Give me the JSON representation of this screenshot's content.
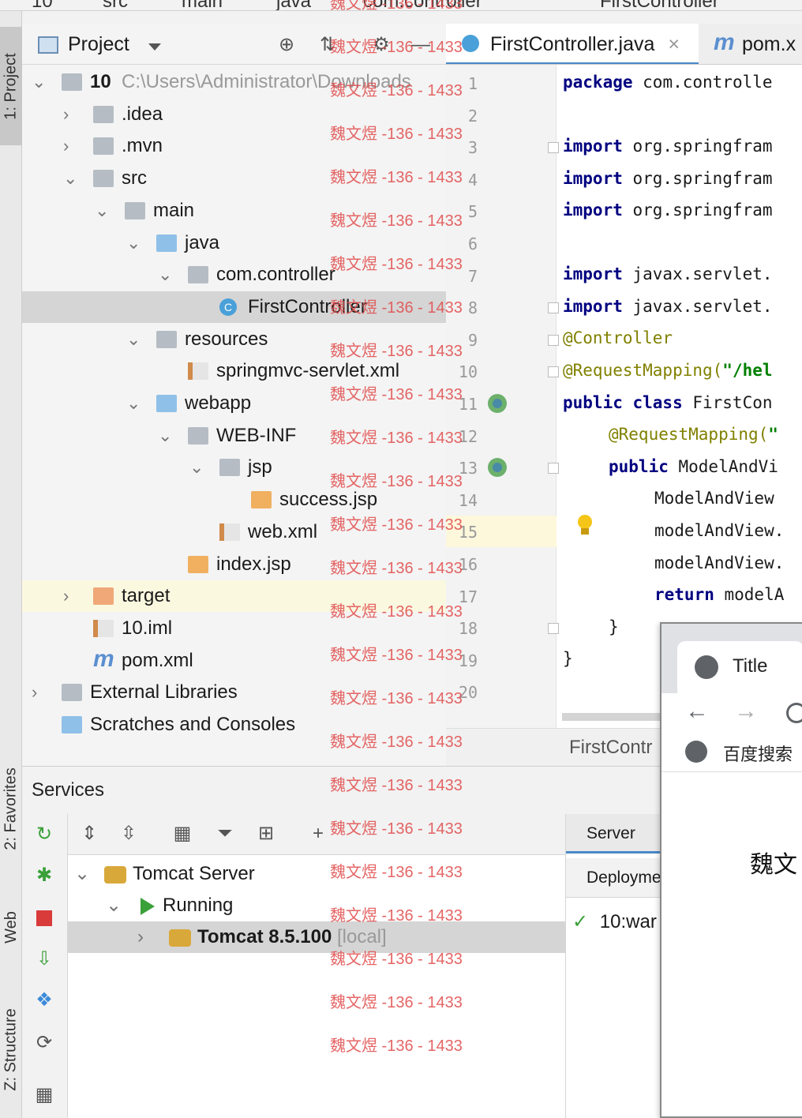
{
  "breadcrumbs": [
    "10",
    "src",
    "main",
    "java",
    "com.controller",
    "FirstController"
  ],
  "left_strip": {
    "tabs": [
      {
        "label": "1: Project"
      },
      {
        "label": "2: Favorites"
      },
      {
        "label": "Web"
      },
      {
        "label": "Z: Structure"
      }
    ]
  },
  "project_panel": {
    "title": "Project",
    "tree": [
      {
        "level": 0,
        "expanded": true,
        "icon": "module-folder-icon",
        "name": "10",
        "path": "C:\\Users\\Administrator\\Downloads"
      },
      {
        "level": 1,
        "expanded": false,
        "icon": "folder-icon",
        "name": ".idea"
      },
      {
        "level": 1,
        "expanded": false,
        "icon": "folder-icon",
        "name": ".mvn"
      },
      {
        "level": 1,
        "expanded": true,
        "icon": "folder-icon",
        "name": "src"
      },
      {
        "level": 2,
        "expanded": true,
        "icon": "folder-icon",
        "name": "main"
      },
      {
        "level": 3,
        "expanded": true,
        "icon": "source-folder-icon",
        "name": "java"
      },
      {
        "level": 4,
        "expanded": true,
        "icon": "package-icon",
        "name": "com.controller"
      },
      {
        "level": 5,
        "icon": "class-icon",
        "name": "FirstController",
        "selected": true
      },
      {
        "level": 3,
        "expanded": true,
        "icon": "resources-folder-icon",
        "name": "resources"
      },
      {
        "level": 4,
        "icon": "xml-file-icon",
        "name": "springmvc-servlet.xml"
      },
      {
        "level": 3,
        "expanded": true,
        "icon": "web-folder-icon",
        "name": "webapp"
      },
      {
        "level": 4,
        "expanded": true,
        "icon": "folder-icon",
        "name": "WEB-INF"
      },
      {
        "level": 5,
        "expanded": true,
        "icon": "folder-icon",
        "name": "jsp"
      },
      {
        "level": 6,
        "icon": "jsp-file-icon",
        "name": "success.jsp"
      },
      {
        "level": 5,
        "icon": "xml-file-icon",
        "name": "web.xml"
      },
      {
        "level": 4,
        "icon": "jsp-file-icon",
        "name": "index.jsp"
      },
      {
        "level": 1,
        "expanded": false,
        "icon": "excluded-folder-icon",
        "name": "target",
        "highlight": true
      },
      {
        "level": 1,
        "icon": "iml-file-icon",
        "name": "10.iml"
      },
      {
        "level": 1,
        "icon": "maven-icon",
        "name": "pom.xml"
      },
      {
        "level": 0,
        "expanded": false,
        "icon": "libraries-icon",
        "name": "External Libraries"
      },
      {
        "level": 0,
        "icon": "scratches-icon",
        "name": "Scratches and Consoles"
      }
    ]
  },
  "editor": {
    "tabs": [
      {
        "label": "FirstController.java",
        "active": true
      },
      {
        "label": "pom.x"
      }
    ],
    "line_numbers": [
      "1",
      "2",
      "3",
      "4",
      "5",
      "6",
      "7",
      "8",
      "9",
      "10",
      "11",
      "12",
      "13",
      "14",
      "15",
      "16",
      "17",
      "18",
      "19",
      "20"
    ],
    "footer_label": "FirstContr"
  },
  "code": {
    "l1": {
      "kw": "package",
      "rest": " com.controlle"
    },
    "l3": {
      "kw": "import",
      "rest": " org.springfram"
    },
    "l4": {
      "kw": "import",
      "rest": " org.springfram"
    },
    "l5": {
      "kw": "import",
      "rest": " org.springfram"
    },
    "l7": {
      "kw": "import",
      "rest": " javax.servlet."
    },
    "l8": {
      "kw": "import",
      "rest": " javax.servlet."
    },
    "l9": {
      "ann": "@Controller"
    },
    "l10": {
      "ann": "@RequestMapping(",
      "str": "\"/hel"
    },
    "l11": {
      "kw": "public class",
      "rest": " FirstCon"
    },
    "l12": {
      "ann": "@RequestMapping(",
      "str": "\""
    },
    "l13": {
      "kw": "public",
      "rest": " ModelAndVi"
    },
    "l14": {
      "rest": "ModelAndView"
    },
    "l15": {
      "rest": "modelAndView."
    },
    "l16": {
      "rest": "modelAndView."
    },
    "l17": {
      "kw": "return",
      "rest": " modelA"
    },
    "l18": {
      "rest": "}"
    },
    "l19": {
      "rest": "}"
    }
  },
  "browser": {
    "tab_title": "Title",
    "nav": {
      "back": "←",
      "forward": "→"
    },
    "bookmark": "百度搜索",
    "content_text": "魏文"
  },
  "services": {
    "title": "Services",
    "tree": [
      {
        "level": 0,
        "expanded": true,
        "icon": "tomcat-icon",
        "name": "Tomcat Server"
      },
      {
        "level": 1,
        "expanded": true,
        "icon": "run-icon",
        "name": "Running"
      },
      {
        "level": 2,
        "expanded": false,
        "icon": "tomcat-icon",
        "name": "Tomcat 8.5.100",
        "suffix": "[local]",
        "selected": true
      }
    ],
    "detail_tabs": [
      {
        "label": "Server"
      },
      {
        "label": "Deployme"
      }
    ],
    "deployment": {
      "name": "10:war"
    }
  },
  "watermark": "魏文煜 -136 - 1433",
  "colors": {
    "selection": "#d5d5d5",
    "keyword": "#000080",
    "annotation": "#808000",
    "string": "#008000",
    "watermark": "#e14b4b",
    "current_line": "#fdf8dc"
  }
}
